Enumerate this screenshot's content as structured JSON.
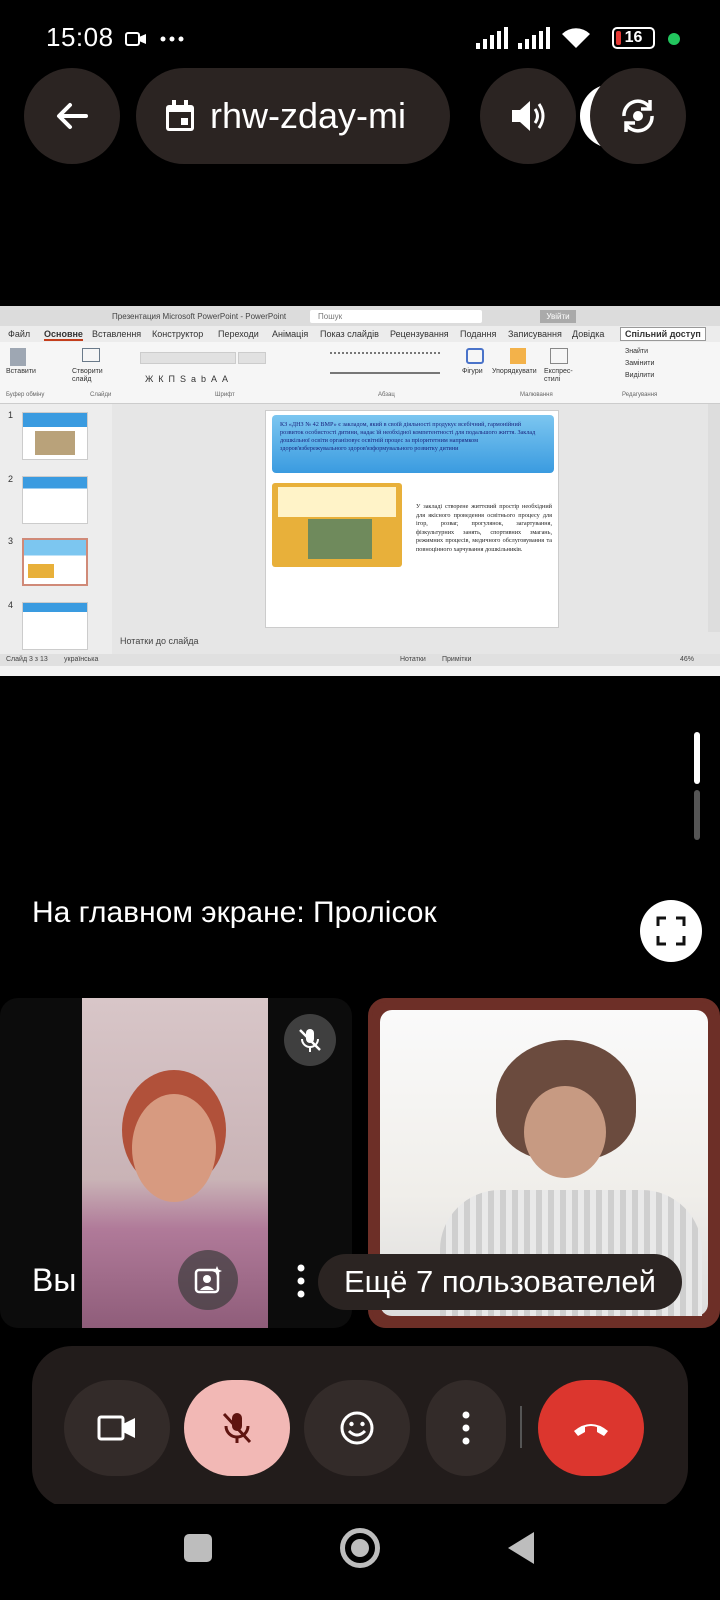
{
  "status_bar": {
    "time": "15:08",
    "battery": "16",
    "dot_color": "#22c55e",
    "icons": [
      "video-camera-icon",
      "more-dots-icon",
      "signal-icon",
      "signal-icon",
      "wifi-icon"
    ]
  },
  "top_bar": {
    "meeting_code": "rhw-zday-mi",
    "icons": [
      "back-arrow-icon",
      "calendar-icon",
      "volume-icon",
      "switch-camera-icon"
    ]
  },
  "presentation": {
    "window_title": "Презентация Microsoft PowerPoint - PowerPoint",
    "search_placeholder": "Пошук",
    "signin": "Увійти",
    "tabs": [
      "Файл",
      "Основне",
      "Вставлення",
      "Конструктор",
      "Переходи",
      "Анімація",
      "Показ слайдів",
      "Рецензування",
      "Подання",
      "Записування",
      "Довідка"
    ],
    "share": "Спільний доступ",
    "ribbon": {
      "paste": "Вставити",
      "new_slide": "Створити слайд",
      "shapes": "Фігури",
      "arrange": "Упорядкувати",
      "quick_styles": "Експрес-стилі",
      "find": "Знайти",
      "replace": "Замінити",
      "select": "Виділити",
      "group_clipboard": "Буфер обміну",
      "group_slides": "Слайди",
      "group_font": "Шрифт",
      "group_paragraph": "Абзац",
      "group_drawing": "Малювання",
      "group_editing": "Редагування"
    },
    "thumb_numbers": [
      "1",
      "2",
      "3",
      "4"
    ],
    "slide_banner_text": "КЗ «ДНЗ № 42 ВМР» є закладом, який в своїй діяльності продукує всебічний, гармонійний розвиток особистості дитини, надає їй необхідної компетентності для подальшого життя. Заклад дошкільної освіти організовує освітній процес за пріоритетним напрямком здоров'язбережувального здоров'язформувального розвитку дитини",
    "slide_body_text": "У закладі створене життєвий простір необхідний для якісного проведення освітнього процесу для ігор, розваг, прогулянок, загартування, фізкультурних занять, спортивних змагань, режимних процесів, медичного обслуговування та повноцінного харчування дошкільників.",
    "notes_label": "Нотатки до слайда",
    "status_left": "Слайд 3 з 13",
    "status_lang": "українська",
    "notes_btn": "Нотатки",
    "comments_btn": "Примітки",
    "zoom": "46%"
  },
  "meeting": {
    "main_screen_label": "На главном экране: Пролісок",
    "you_label": "Вы",
    "more_users": "Ещё 7 пользователей"
  },
  "controls": {
    "camera": "camera-icon",
    "mic": "mic-off-icon",
    "emoji": "emoji-icon",
    "more": "more-vert-icon",
    "hangup": "hang-up-icon",
    "mic_bg": "#f2b8b5",
    "hangup_bg": "#dc362e"
  }
}
